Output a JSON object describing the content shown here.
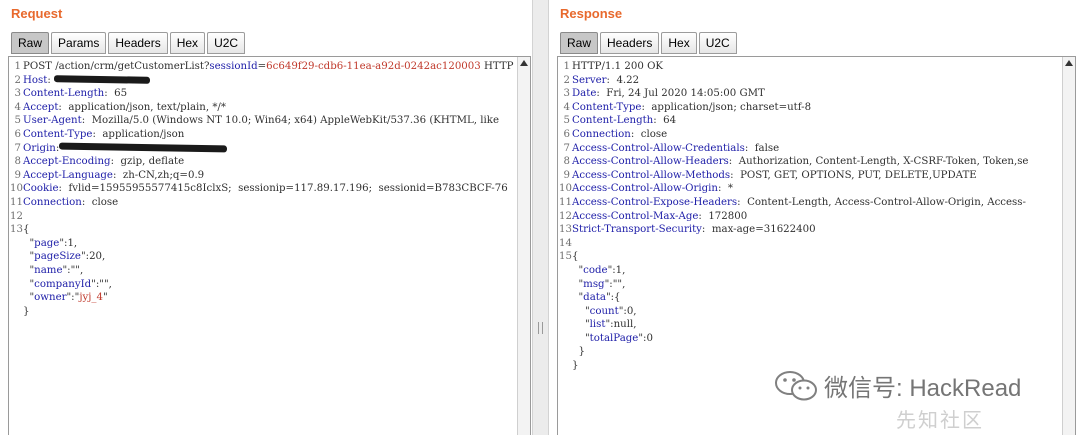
{
  "request": {
    "title": "Request",
    "tabs": [
      "Raw",
      "Params",
      "Headers",
      "Hex",
      "U2C"
    ],
    "lines": [
      {
        "n": "1",
        "parts": [
          [
            "t",
            "POST /action/crm/getCustomerList?"
          ],
          [
            "k",
            "sessionId"
          ],
          [
            "t",
            "="
          ],
          [
            "q",
            "6c649f29-cdb6-11ea-a92d-0242ac120003"
          ],
          [
            "t",
            " HTTP"
          ]
        ]
      },
      {
        "n": "2",
        "parts": [
          [
            "k",
            "Host"
          ],
          [
            "t",
            ": "
          ],
          [
            "r",
            "96"
          ]
        ]
      },
      {
        "n": "3",
        "parts": [
          [
            "k",
            "Content-Length"
          ],
          [
            "t",
            ":  65"
          ]
        ]
      },
      {
        "n": "4",
        "parts": [
          [
            "k",
            "Accept"
          ],
          [
            "t",
            ":  application/json, text/plain, */*"
          ]
        ]
      },
      {
        "n": "5",
        "parts": [
          [
            "k",
            "User-Agent"
          ],
          [
            "t",
            ":  Mozilla/5.0 (Windows NT 10.0; Win64; x64) AppleWebKit/537.36 (KHTML, like"
          ]
        ]
      },
      {
        "n": "6",
        "parts": [
          [
            "k",
            "Content-Type"
          ],
          [
            "t",
            ":  application/json"
          ]
        ]
      },
      {
        "n": "7",
        "parts": [
          [
            "k",
            "Origin"
          ],
          [
            "t",
            ":"
          ],
          [
            "r",
            "168"
          ]
        ]
      },
      {
        "n": "8",
        "parts": [
          [
            "k",
            "Accept-Encoding"
          ],
          [
            "t",
            ":  gzip, deflate"
          ]
        ]
      },
      {
        "n": "9",
        "parts": [
          [
            "k",
            "Accept-Language"
          ],
          [
            "t",
            ":  zh-CN,zh;q=0.9"
          ]
        ]
      },
      {
        "n": "10",
        "parts": [
          [
            "k",
            "Cookie"
          ],
          [
            "t",
            ":  fvlid=15955955577415c8IclxS;  sessionip=117.89.17.196;  sessionid=B783CBCF-76"
          ]
        ]
      },
      {
        "n": "11",
        "parts": [
          [
            "k",
            "Connection"
          ],
          [
            "t",
            ":  close"
          ]
        ]
      },
      {
        "n": "12",
        "parts": []
      },
      {
        "n": "13",
        "parts": [
          [
            "t",
            "{"
          ]
        ]
      },
      {
        "n": "",
        "parts": [
          [
            "t",
            "  \""
          ],
          [
            "k",
            "page"
          ],
          [
            "t",
            "\":1,"
          ]
        ]
      },
      {
        "n": "",
        "parts": [
          [
            "t",
            "  \""
          ],
          [
            "k",
            "pageSize"
          ],
          [
            "t",
            "\":20,"
          ]
        ]
      },
      {
        "n": "",
        "parts": [
          [
            "t",
            "  \""
          ],
          [
            "k",
            "name"
          ],
          [
            "t",
            "\":\"\","
          ]
        ]
      },
      {
        "n": "",
        "parts": [
          [
            "t",
            "  \""
          ],
          [
            "k",
            "companyId"
          ],
          [
            "t",
            "\":\"\","
          ]
        ]
      },
      {
        "n": "",
        "parts": [
          [
            "t",
            "  \""
          ],
          [
            "k",
            "owner"
          ],
          [
            "t",
            "\":\""
          ],
          [
            "q",
            "jyj_4"
          ],
          [
            "t",
            "\""
          ]
        ]
      },
      {
        "n": "",
        "parts": [
          [
            "t",
            "}"
          ]
        ]
      }
    ]
  },
  "response": {
    "title": "Response",
    "tabs": [
      "Raw",
      "Headers",
      "Hex",
      "U2C"
    ],
    "lines": [
      {
        "n": "1",
        "parts": [
          [
            "t",
            "HTTP/1.1 200 OK"
          ]
        ]
      },
      {
        "n": "2",
        "parts": [
          [
            "k",
            "Server"
          ],
          [
            "t",
            ":  4.22"
          ]
        ]
      },
      {
        "n": "3",
        "parts": [
          [
            "k",
            "Date"
          ],
          [
            "t",
            ":  Fri, 24 Jul 2020 14:05:00 GMT"
          ]
        ]
      },
      {
        "n": "4",
        "parts": [
          [
            "k",
            "Content-Type"
          ],
          [
            "t",
            ":  application/json; charset=utf-8"
          ]
        ]
      },
      {
        "n": "5",
        "parts": [
          [
            "k",
            "Content-Length"
          ],
          [
            "t",
            ":  64"
          ]
        ]
      },
      {
        "n": "6",
        "parts": [
          [
            "k",
            "Connection"
          ],
          [
            "t",
            ":  close"
          ]
        ]
      },
      {
        "n": "7",
        "parts": [
          [
            "k",
            "Access-Control-Allow-Credentials"
          ],
          [
            "t",
            ":  false"
          ]
        ]
      },
      {
        "n": "8",
        "parts": [
          [
            "k",
            "Access-Control-Allow-Headers"
          ],
          [
            "t",
            ":  Authorization, Content-Length, X-CSRF-Token, Token,se"
          ]
        ]
      },
      {
        "n": "9",
        "parts": [
          [
            "k",
            "Access-Control-Allow-Methods"
          ],
          [
            "t",
            ":  POST, GET, OPTIONS, PUT, DELETE,UPDATE"
          ]
        ]
      },
      {
        "n": "10",
        "parts": [
          [
            "k",
            "Access-Control-Allow-Origin"
          ],
          [
            "t",
            ":  *"
          ]
        ]
      },
      {
        "n": "11",
        "parts": [
          [
            "k",
            "Access-Control-Expose-Headers"
          ],
          [
            "t",
            ":  Content-Length, Access-Control-Allow-Origin, Access-"
          ]
        ]
      },
      {
        "n": "12",
        "parts": [
          [
            "k",
            "Access-Control-Max-Age"
          ],
          [
            "t",
            ":  172800"
          ]
        ]
      },
      {
        "n": "13",
        "parts": [
          [
            "k",
            "Strict-Transport-Security"
          ],
          [
            "t",
            ":  max-age=31622400"
          ]
        ]
      },
      {
        "n": "14",
        "parts": []
      },
      {
        "n": "15",
        "parts": [
          [
            "t",
            "{"
          ]
        ]
      },
      {
        "n": "",
        "parts": [
          [
            "t",
            "  \""
          ],
          [
            "k",
            "code"
          ],
          [
            "t",
            "\":1,"
          ]
        ]
      },
      {
        "n": "",
        "parts": [
          [
            "t",
            "  \""
          ],
          [
            "k",
            "msg"
          ],
          [
            "t",
            "\":\"\","
          ]
        ]
      },
      {
        "n": "",
        "parts": [
          [
            "t",
            "  \""
          ],
          [
            "k",
            "data"
          ],
          [
            "t",
            "\":{"
          ]
        ]
      },
      {
        "n": "",
        "parts": [
          [
            "t",
            "    \""
          ],
          [
            "k",
            "count"
          ],
          [
            "t",
            "\":0,"
          ]
        ]
      },
      {
        "n": "",
        "parts": [
          [
            "t",
            "    \""
          ],
          [
            "k",
            "list"
          ],
          [
            "t",
            "\":null,"
          ]
        ]
      },
      {
        "n": "",
        "parts": [
          [
            "t",
            "    \""
          ],
          [
            "k",
            "totalPage"
          ],
          [
            "t",
            "\":0"
          ]
        ]
      },
      {
        "n": "",
        "parts": [
          [
            "t",
            "  }"
          ]
        ]
      },
      {
        "n": "",
        "parts": [
          [
            "t",
            "}"
          ]
        ]
      }
    ]
  },
  "watermark": {
    "main": "微信号: HackRead",
    "sub": "先知社区",
    "icon": "wechat-icon"
  },
  "colors": {
    "title": "#e8692d",
    "key": "#1e1ea8",
    "string": "#c0392b"
  }
}
